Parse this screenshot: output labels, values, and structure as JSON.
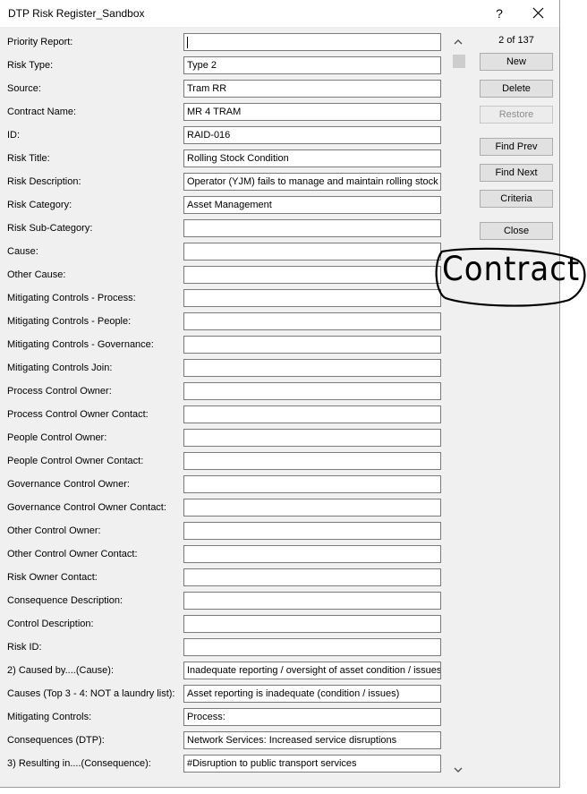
{
  "window": {
    "title": "DTP Risk Register_Sandbox",
    "help_glyph": "?",
    "close_icon": "close-icon"
  },
  "form": {
    "fields": [
      {
        "label": "Priority Report:",
        "value": ""
      },
      {
        "label": "Risk Type:",
        "value": "Type 2"
      },
      {
        "label": "Source:",
        "value": "Tram RR"
      },
      {
        "label": "Contract Name:",
        "value": "MR 4 TRAM"
      },
      {
        "label": "ID:",
        "value": "RAID-016"
      },
      {
        "label": "Risk Title:",
        "value": "Rolling Stock Condition"
      },
      {
        "label": "Risk Description:",
        "value": "Operator (YJM) fails to manage and maintain rolling stock"
      },
      {
        "label": "Risk Category:",
        "value": "Asset Management"
      },
      {
        "label": "Risk Sub-Category:",
        "value": ""
      },
      {
        "label": "Cause:",
        "value": ""
      },
      {
        "label": "Other Cause:",
        "value": ""
      },
      {
        "label": "Mitigating Controls - Process:",
        "value": ""
      },
      {
        "label": "Mitigating Controls - People:",
        "value": ""
      },
      {
        "label": "Mitigating Controls - Governance:",
        "value": ""
      },
      {
        "label": "Mitigating Controls Join:",
        "value": ""
      },
      {
        "label": "Process Control Owner:",
        "value": ""
      },
      {
        "label": "Process Control Owner Contact:",
        "value": ""
      },
      {
        "label": "People Control Owner:",
        "value": ""
      },
      {
        "label": "People Control Owner Contact:",
        "value": ""
      },
      {
        "label": "Governance Control Owner:",
        "value": ""
      },
      {
        "label": "Governance Control Owner Contact:",
        "value": ""
      },
      {
        "label": "Other Control Owner:",
        "value": ""
      },
      {
        "label": "Other Control Owner Contact:",
        "value": ""
      },
      {
        "label": "Risk Owner Contact:",
        "value": ""
      },
      {
        "label": "Consequence Description:",
        "value": ""
      },
      {
        "label": "Control Description:",
        "value": ""
      },
      {
        "label": "Risk ID:",
        "value": ""
      },
      {
        "label": "2) Caused by....(Cause):",
        "value": "Inadequate reporting / oversight of asset condition / issues"
      },
      {
        "label": "Causes (Top 3 - 4: NOT a laundry list):",
        "value": "Asset reporting is inadequate (condition / issues)"
      },
      {
        "label": "Mitigating Controls:",
        "value": "Process:"
      },
      {
        "label": "Consequences (DTP):",
        "value": "Network Services: Increased service disruptions"
      },
      {
        "label": "3) Resulting in....(Consequence):",
        "value": "#Disruption to public transport services"
      }
    ]
  },
  "record_counter": "2 of 137",
  "buttons": {
    "new": "New",
    "delete": "Delete",
    "restore": "Restore",
    "find_prev": "Find Prev",
    "find_next": "Find Next",
    "criteria": "Criteria",
    "close": "Close"
  },
  "annotation": {
    "text": "Contract"
  }
}
